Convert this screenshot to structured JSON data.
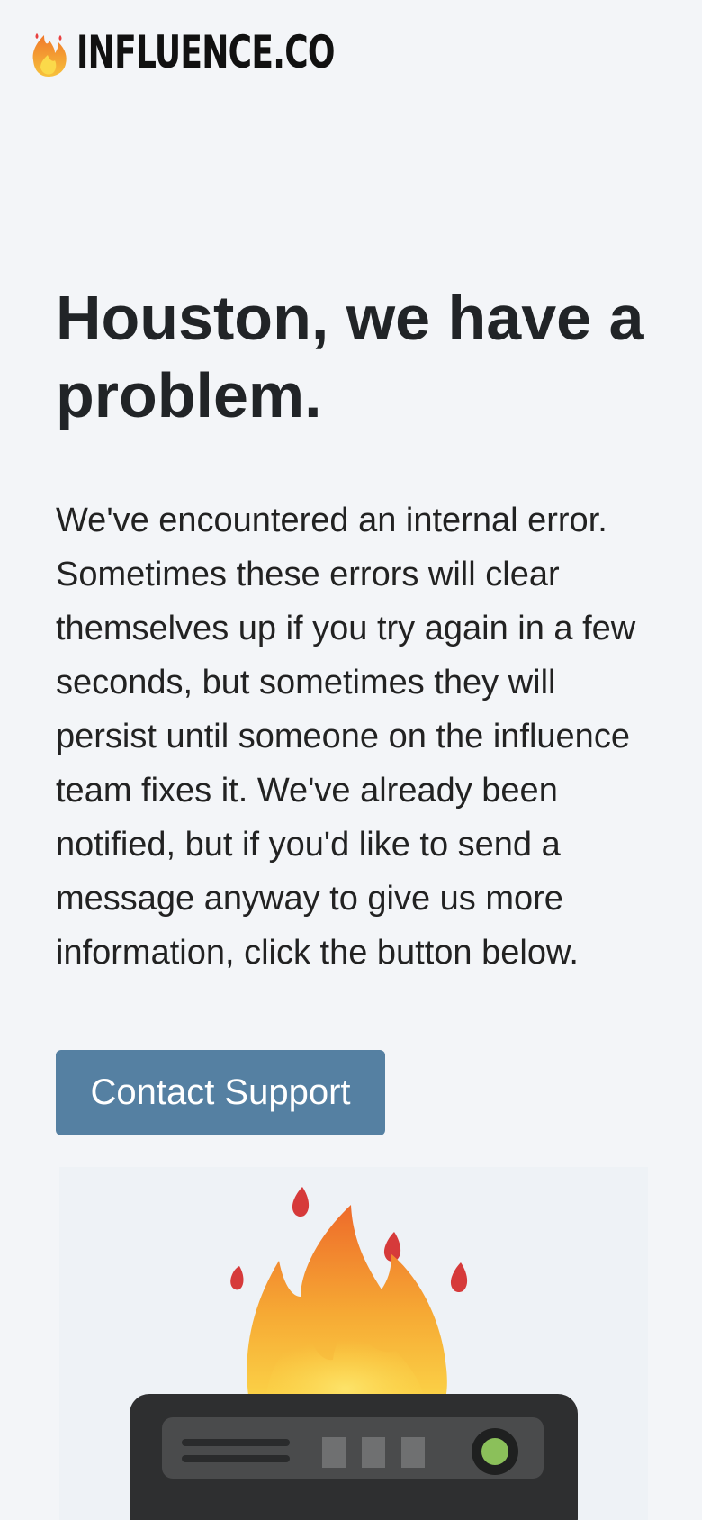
{
  "header": {
    "logo_icon": "fire-icon",
    "logo_text": "INFLUENCE.CO"
  },
  "main": {
    "headline": "Houston, we have a problem.",
    "message": "We've encountered an internal error. Sometimes these errors will clear themselves up if you try again in a few seconds, but sometimes they will persist until someone on the influence team fixes it. We've already been notified, but if you'd like to send a message anyway to give us more information, click the button below.",
    "contact_button_label": "Contact Support"
  },
  "illustration": {
    "icon": "server-on-fire-icon"
  },
  "colors": {
    "background": "#f3f5f8",
    "button": "#5580a2",
    "text": "#212427"
  }
}
